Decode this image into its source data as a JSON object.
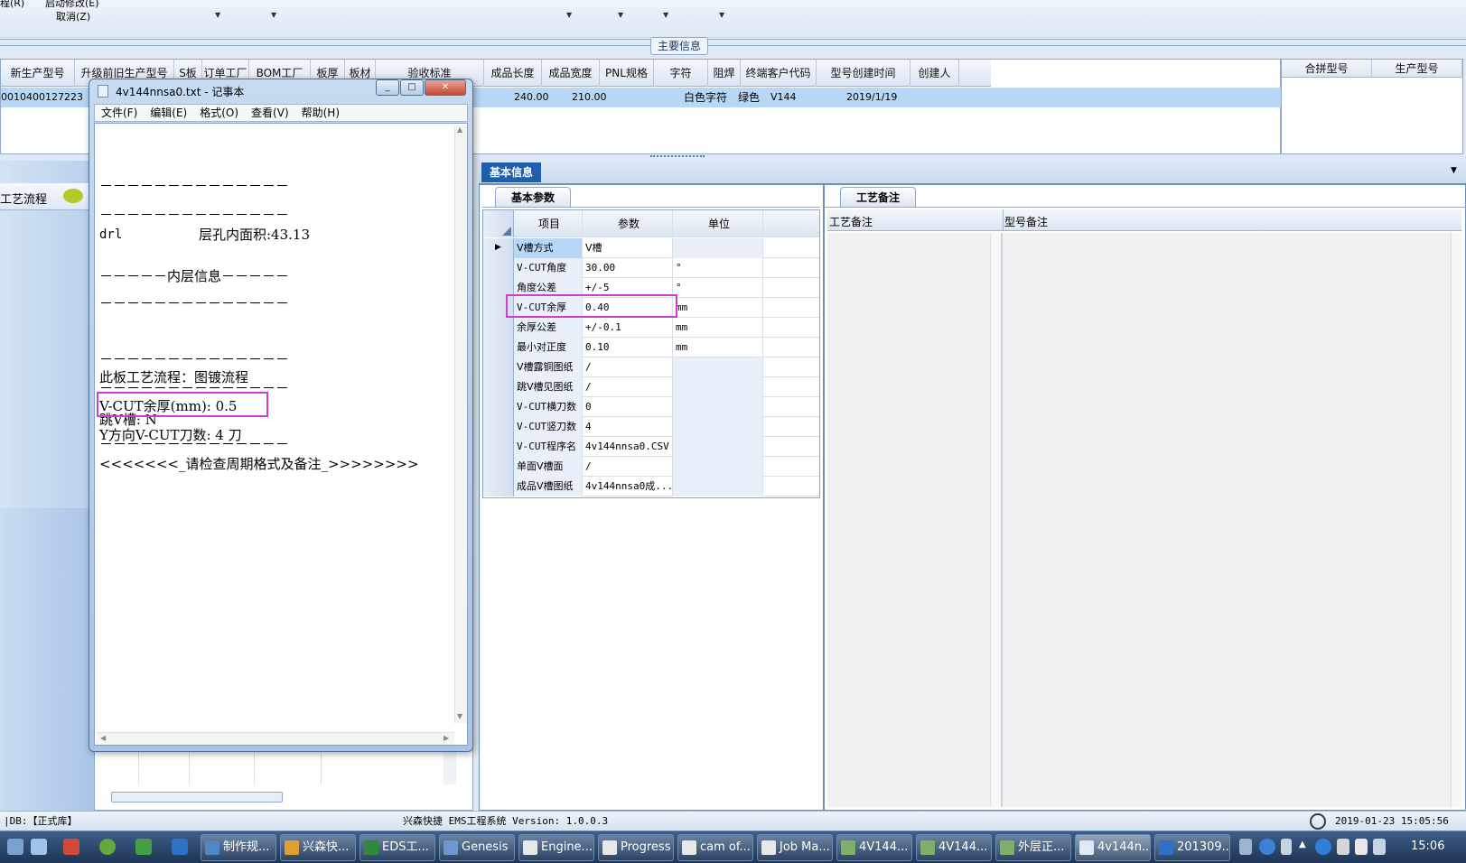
{
  "topbar": {
    "menu_cut": "程(R)",
    "menu_cut2": "启动修改(E)",
    "cancel": "取消(Z)"
  },
  "maininfo": {
    "group_title": "主要信息",
    "columns": [
      "新生产型号",
      "升级前旧生产型号",
      "S板",
      "订单工厂",
      "BOM工厂",
      "板厚",
      "板材",
      "验收标准",
      "成品长度",
      "成品宽度",
      "PNL规格",
      "字符",
      "阻焊",
      "终端客户代码",
      "型号创建时间",
      "创建人"
    ],
    "row": {
      "model": "0010400127223",
      "length": "240.00",
      "width": "210.00",
      "legend": "白色字符",
      "mask": "绿色",
      "customer": "V144",
      "created": "2019/1/19"
    },
    "right_columns": [
      "合拼型号",
      "生产型号"
    ]
  },
  "leftpane": {
    "tab_label": "工艺流程"
  },
  "basicinfo": {
    "panel_tab": "基本信息",
    "subtab": "基本参数",
    "columns": [
      "项目",
      "参数",
      "单位"
    ],
    "rows": [
      {
        "item": "V槽方式",
        "param": "V槽",
        "unit": ""
      },
      {
        "item": "V-CUT角度",
        "param": "30.00",
        "unit": "°"
      },
      {
        "item": "角度公差",
        "param": "+/-5",
        "unit": "°"
      },
      {
        "item": "V-CUT余厚",
        "param": "0.40",
        "unit": "mm"
      },
      {
        "item": "余厚公差",
        "param": "+/-0.1",
        "unit": "mm"
      },
      {
        "item": "最小对正度",
        "param": "0.10",
        "unit": "mm"
      },
      {
        "item": "V槽露铜图纸",
        "param": "/",
        "unit": ""
      },
      {
        "item": "跳V槽见图纸",
        "param": "/",
        "unit": ""
      },
      {
        "item": "V-CUT横刀数",
        "param": "0",
        "unit": ""
      },
      {
        "item": "V-CUT竖刀数",
        "param": "4",
        "unit": ""
      },
      {
        "item": "V-CUT程序名",
        "param": "4v144nnsa0.CSV",
        "unit": ""
      },
      {
        "item": "单面V槽面",
        "param": "/",
        "unit": ""
      },
      {
        "item": "成品V槽图纸",
        "param": "4v144nnsa0成...",
        "unit": ""
      }
    ]
  },
  "remarks": {
    "tab": "工艺备注",
    "col1": "工艺备注",
    "col2": "型号备注"
  },
  "notepad": {
    "title": "4v144nnsa0.txt - 记事本",
    "menu": [
      "文件(F)",
      "编辑(E)",
      "格式(O)",
      "查看(V)",
      "帮助(H)"
    ],
    "dash": "－－－－－－－－－－－－－－",
    "drl_label": "drl",
    "drl_area": "层孔内面积:43.13",
    "inner": "－－－－－内层信息－－－－－",
    "flow": "此板工艺流程：图镀流程",
    "vcut": "V-CUT余厚(mm): 0.5",
    "skip": "跳V槽: N",
    "ycut": "Y方向V-CUT刀数: 4 刀",
    "check": "<<<<<<<_请检查周期格式及备注_>>>>>>>>"
  },
  "statusbar": {
    "db": "|DB:【正式库】",
    "system": "兴森快捷 EMS工程系统 Version: 1.0.0.3",
    "time": "2019-01-23 15:05:56"
  },
  "taskbar": {
    "buttons": [
      "制作规...",
      "兴森快...",
      "EDS工...",
      "Genesis",
      "Engine...",
      "Progress",
      "cam of...",
      "Job Ma...",
      "4V144...",
      "4V144...",
      "外层正...",
      "4v144n...",
      "201309..."
    ],
    "clock": "15:06"
  },
  "colors": {
    "highlight": "#d23ad2",
    "selected_row": "#b7d7f7",
    "accent": "#1f5fae"
  }
}
